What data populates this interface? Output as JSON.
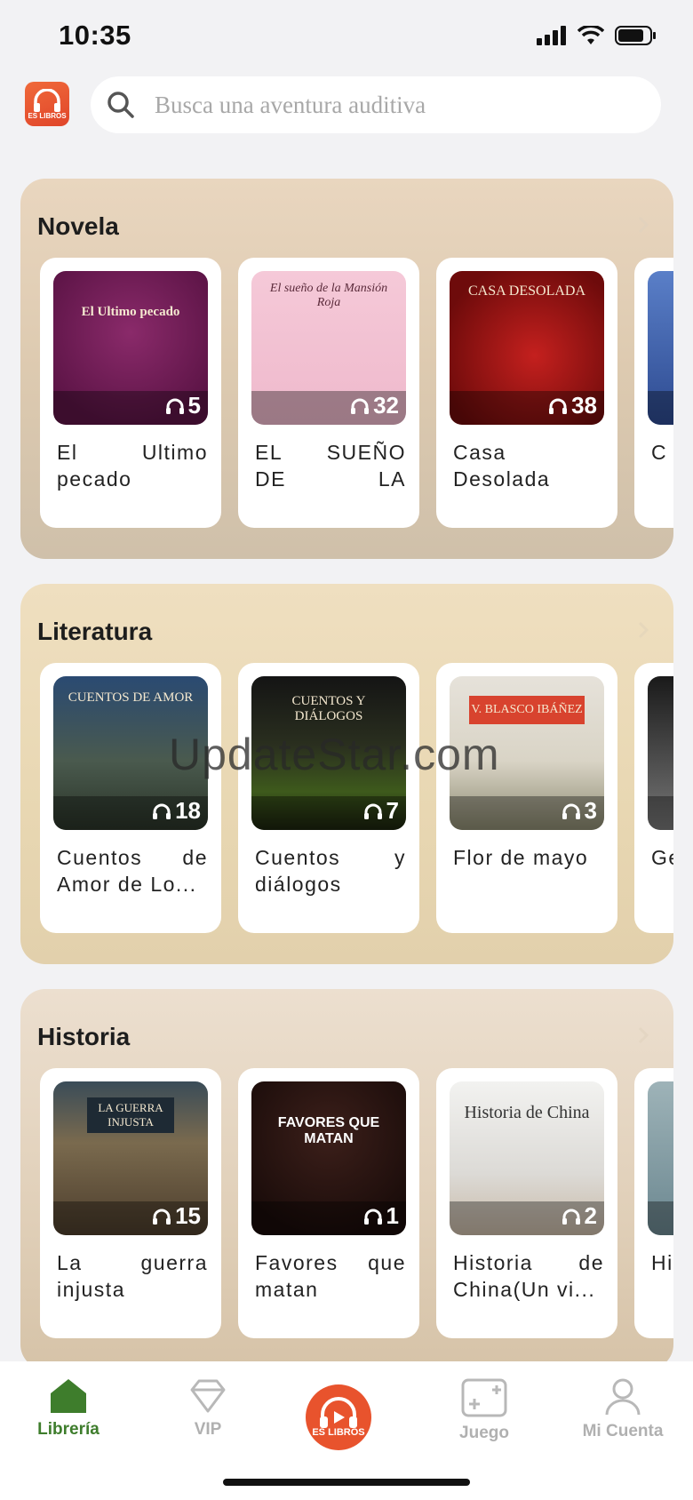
{
  "status_bar": {
    "time": "10:35"
  },
  "search": {
    "placeholder": "Busca una aventura auditiva"
  },
  "logo": {
    "text": "ES LIBROS"
  },
  "sections": [
    {
      "title": "Novela",
      "books": [
        {
          "title": "El Ultimo pecado",
          "cover_text": "El Ultimo pecado",
          "listens": "5"
        },
        {
          "title": "EL SUEÑO DE LA MANSIÓ...",
          "cover_text": "El sueño de la Mansión Roja",
          "listens": "32"
        },
        {
          "title": "Casa Desolada Vo...",
          "cover_text": "CASA DESOLADA",
          "listens": "38"
        },
        {
          "title": "C De",
          "cover_text": "",
          "listens": ""
        }
      ]
    },
    {
      "title": "Literatura",
      "books": [
        {
          "title": "Cuentos de Amor de Lo...",
          "cover_text": "CUENTOS DE AMOR",
          "listens": "18"
        },
        {
          "title": "Cuentos y diálogos",
          "cover_text": "CUENTOS Y DIÁLOGOS",
          "listens": "7"
        },
        {
          "title": "Flor de mayo",
          "cover_text": "V. BLASCO IBÁÑEZ",
          "listens": "3"
        },
        {
          "title": "Ge",
          "cover_text": "",
          "listens": ""
        }
      ]
    },
    {
      "title": "Historia",
      "books": [
        {
          "title": "La guerra injusta",
          "cover_text": "LA GUERRA INJUSTA",
          "listens": "15"
        },
        {
          "title": "Favores que matan",
          "cover_text": "FAVORES QUE MATAN",
          "listens": "1"
        },
        {
          "title": "Historia de China(Un vi...",
          "cover_text": "Historia de China",
          "listens": "2"
        },
        {
          "title": "His vic",
          "cover_text": "",
          "listens": ""
        }
      ]
    }
  ],
  "tabs": [
    {
      "label": "Librería",
      "active": true
    },
    {
      "label": "VIP",
      "active": false
    },
    {
      "label": "Juego",
      "active": false
    },
    {
      "label": "Mi Cuenta",
      "active": false
    }
  ],
  "watermark": "UpdateStar.com",
  "colors": {
    "accent": "#e8532d",
    "active_tab": "#3e7d2c"
  }
}
